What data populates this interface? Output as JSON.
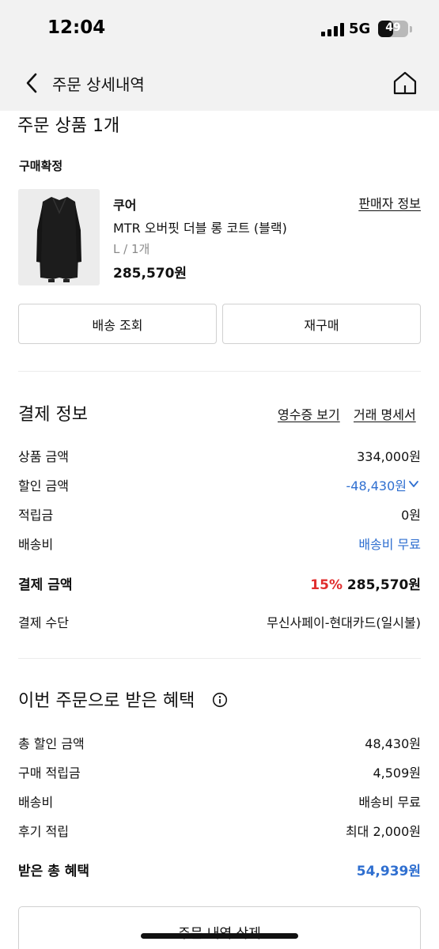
{
  "status_bar": {
    "time": "12:04",
    "network": "5G",
    "battery": "49",
    "battery_level": 0.49
  },
  "nav": {
    "title": "주문 상세내역",
    "back_icon": "chevron-left-icon",
    "home_icon": "home-icon"
  },
  "order": {
    "section_title": "주문 상품 1개",
    "status": "구매확정",
    "product": {
      "brand": "쿠어",
      "seller_link": "판매자 정보",
      "name": "MTR 오버핏 더블 롱 코트 (블랙)",
      "option": "L / 1개",
      "price": "285,570원"
    },
    "buttons": {
      "tracking": "배송 조회",
      "rebuy": "재구매"
    }
  },
  "payment": {
    "title": "결제 정보",
    "receipt_link": "영수증 보기",
    "statement_link": "거래 명세서",
    "rows": [
      {
        "label": "상품 금액",
        "value": "334,000원"
      },
      {
        "label": "할인 금액",
        "value": "-48,430원"
      },
      {
        "label": "적립금",
        "value": "0원"
      },
      {
        "label": "배송비",
        "value": "배송비 무료"
      }
    ],
    "total_label": "결제 금액",
    "discount_rate": "15%",
    "total_value": "285,570원",
    "method_label": "결제 수단",
    "method_value": "무신사페이-현대카드(일시불)"
  },
  "benefits": {
    "title": "이번 주문으로 받은 혜택",
    "rows": [
      {
        "label": "총 할인 금액",
        "value": "48,430원"
      },
      {
        "label": "구매 적립금",
        "value": "4,509원"
      },
      {
        "label": "배송비",
        "value": "배송비 무료"
      },
      {
        "label": "후기 적립",
        "value": "최대 2,000원"
      }
    ],
    "total_label": "받은 총 혜택",
    "total_value": "54,939원"
  },
  "delete_button": "주문 내역 삭제",
  "colors": {
    "accent_blue": "#2f6fd0",
    "accent_red": "#e02d2d",
    "header_bg": "#f2f2f2"
  }
}
